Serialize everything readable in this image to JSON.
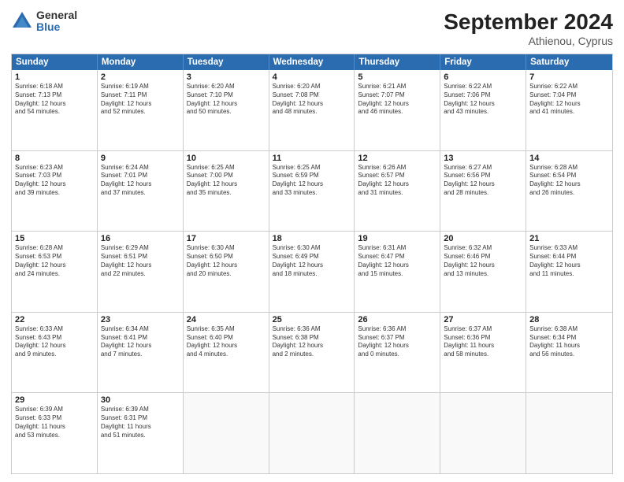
{
  "logo": {
    "general": "General",
    "blue": "Blue"
  },
  "header": {
    "month": "September 2024",
    "location": "Athienou, Cyprus"
  },
  "days": [
    "Sunday",
    "Monday",
    "Tuesday",
    "Wednesday",
    "Thursday",
    "Friday",
    "Saturday"
  ],
  "rows": [
    [
      {
        "day": "1",
        "lines": [
          "Sunrise: 6:18 AM",
          "Sunset: 7:13 PM",
          "Daylight: 12 hours",
          "and 54 minutes."
        ]
      },
      {
        "day": "2",
        "lines": [
          "Sunrise: 6:19 AM",
          "Sunset: 7:11 PM",
          "Daylight: 12 hours",
          "and 52 minutes."
        ]
      },
      {
        "day": "3",
        "lines": [
          "Sunrise: 6:20 AM",
          "Sunset: 7:10 PM",
          "Daylight: 12 hours",
          "and 50 minutes."
        ]
      },
      {
        "day": "4",
        "lines": [
          "Sunrise: 6:20 AM",
          "Sunset: 7:08 PM",
          "Daylight: 12 hours",
          "and 48 minutes."
        ]
      },
      {
        "day": "5",
        "lines": [
          "Sunrise: 6:21 AM",
          "Sunset: 7:07 PM",
          "Daylight: 12 hours",
          "and 46 minutes."
        ]
      },
      {
        "day": "6",
        "lines": [
          "Sunrise: 6:22 AM",
          "Sunset: 7:06 PM",
          "Daylight: 12 hours",
          "and 43 minutes."
        ]
      },
      {
        "day": "7",
        "lines": [
          "Sunrise: 6:22 AM",
          "Sunset: 7:04 PM",
          "Daylight: 12 hours",
          "and 41 minutes."
        ]
      }
    ],
    [
      {
        "day": "8",
        "lines": [
          "Sunrise: 6:23 AM",
          "Sunset: 7:03 PM",
          "Daylight: 12 hours",
          "and 39 minutes."
        ]
      },
      {
        "day": "9",
        "lines": [
          "Sunrise: 6:24 AM",
          "Sunset: 7:01 PM",
          "Daylight: 12 hours",
          "and 37 minutes."
        ]
      },
      {
        "day": "10",
        "lines": [
          "Sunrise: 6:25 AM",
          "Sunset: 7:00 PM",
          "Daylight: 12 hours",
          "and 35 minutes."
        ]
      },
      {
        "day": "11",
        "lines": [
          "Sunrise: 6:25 AM",
          "Sunset: 6:59 PM",
          "Daylight: 12 hours",
          "and 33 minutes."
        ]
      },
      {
        "day": "12",
        "lines": [
          "Sunrise: 6:26 AM",
          "Sunset: 6:57 PM",
          "Daylight: 12 hours",
          "and 31 minutes."
        ]
      },
      {
        "day": "13",
        "lines": [
          "Sunrise: 6:27 AM",
          "Sunset: 6:56 PM",
          "Daylight: 12 hours",
          "and 28 minutes."
        ]
      },
      {
        "day": "14",
        "lines": [
          "Sunrise: 6:28 AM",
          "Sunset: 6:54 PM",
          "Daylight: 12 hours",
          "and 26 minutes."
        ]
      }
    ],
    [
      {
        "day": "15",
        "lines": [
          "Sunrise: 6:28 AM",
          "Sunset: 6:53 PM",
          "Daylight: 12 hours",
          "and 24 minutes."
        ]
      },
      {
        "day": "16",
        "lines": [
          "Sunrise: 6:29 AM",
          "Sunset: 6:51 PM",
          "Daylight: 12 hours",
          "and 22 minutes."
        ]
      },
      {
        "day": "17",
        "lines": [
          "Sunrise: 6:30 AM",
          "Sunset: 6:50 PM",
          "Daylight: 12 hours",
          "and 20 minutes."
        ]
      },
      {
        "day": "18",
        "lines": [
          "Sunrise: 6:30 AM",
          "Sunset: 6:49 PM",
          "Daylight: 12 hours",
          "and 18 minutes."
        ]
      },
      {
        "day": "19",
        "lines": [
          "Sunrise: 6:31 AM",
          "Sunset: 6:47 PM",
          "Daylight: 12 hours",
          "and 15 minutes."
        ]
      },
      {
        "day": "20",
        "lines": [
          "Sunrise: 6:32 AM",
          "Sunset: 6:46 PM",
          "Daylight: 12 hours",
          "and 13 minutes."
        ]
      },
      {
        "day": "21",
        "lines": [
          "Sunrise: 6:33 AM",
          "Sunset: 6:44 PM",
          "Daylight: 12 hours",
          "and 11 minutes."
        ]
      }
    ],
    [
      {
        "day": "22",
        "lines": [
          "Sunrise: 6:33 AM",
          "Sunset: 6:43 PM",
          "Daylight: 12 hours",
          "and 9 minutes."
        ]
      },
      {
        "day": "23",
        "lines": [
          "Sunrise: 6:34 AM",
          "Sunset: 6:41 PM",
          "Daylight: 12 hours",
          "and 7 minutes."
        ]
      },
      {
        "day": "24",
        "lines": [
          "Sunrise: 6:35 AM",
          "Sunset: 6:40 PM",
          "Daylight: 12 hours",
          "and 4 minutes."
        ]
      },
      {
        "day": "25",
        "lines": [
          "Sunrise: 6:36 AM",
          "Sunset: 6:38 PM",
          "Daylight: 12 hours",
          "and 2 minutes."
        ]
      },
      {
        "day": "26",
        "lines": [
          "Sunrise: 6:36 AM",
          "Sunset: 6:37 PM",
          "Daylight: 12 hours",
          "and 0 minutes."
        ]
      },
      {
        "day": "27",
        "lines": [
          "Sunrise: 6:37 AM",
          "Sunset: 6:36 PM",
          "Daylight: 11 hours",
          "and 58 minutes."
        ]
      },
      {
        "day": "28",
        "lines": [
          "Sunrise: 6:38 AM",
          "Sunset: 6:34 PM",
          "Daylight: 11 hours",
          "and 56 minutes."
        ]
      }
    ],
    [
      {
        "day": "29",
        "lines": [
          "Sunrise: 6:39 AM",
          "Sunset: 6:33 PM",
          "Daylight: 11 hours",
          "and 53 minutes."
        ]
      },
      {
        "day": "30",
        "lines": [
          "Sunrise: 6:39 AM",
          "Sunset: 6:31 PM",
          "Daylight: 11 hours",
          "and 51 minutes."
        ]
      },
      {
        "day": "",
        "lines": []
      },
      {
        "day": "",
        "lines": []
      },
      {
        "day": "",
        "lines": []
      },
      {
        "day": "",
        "lines": []
      },
      {
        "day": "",
        "lines": []
      }
    ]
  ]
}
